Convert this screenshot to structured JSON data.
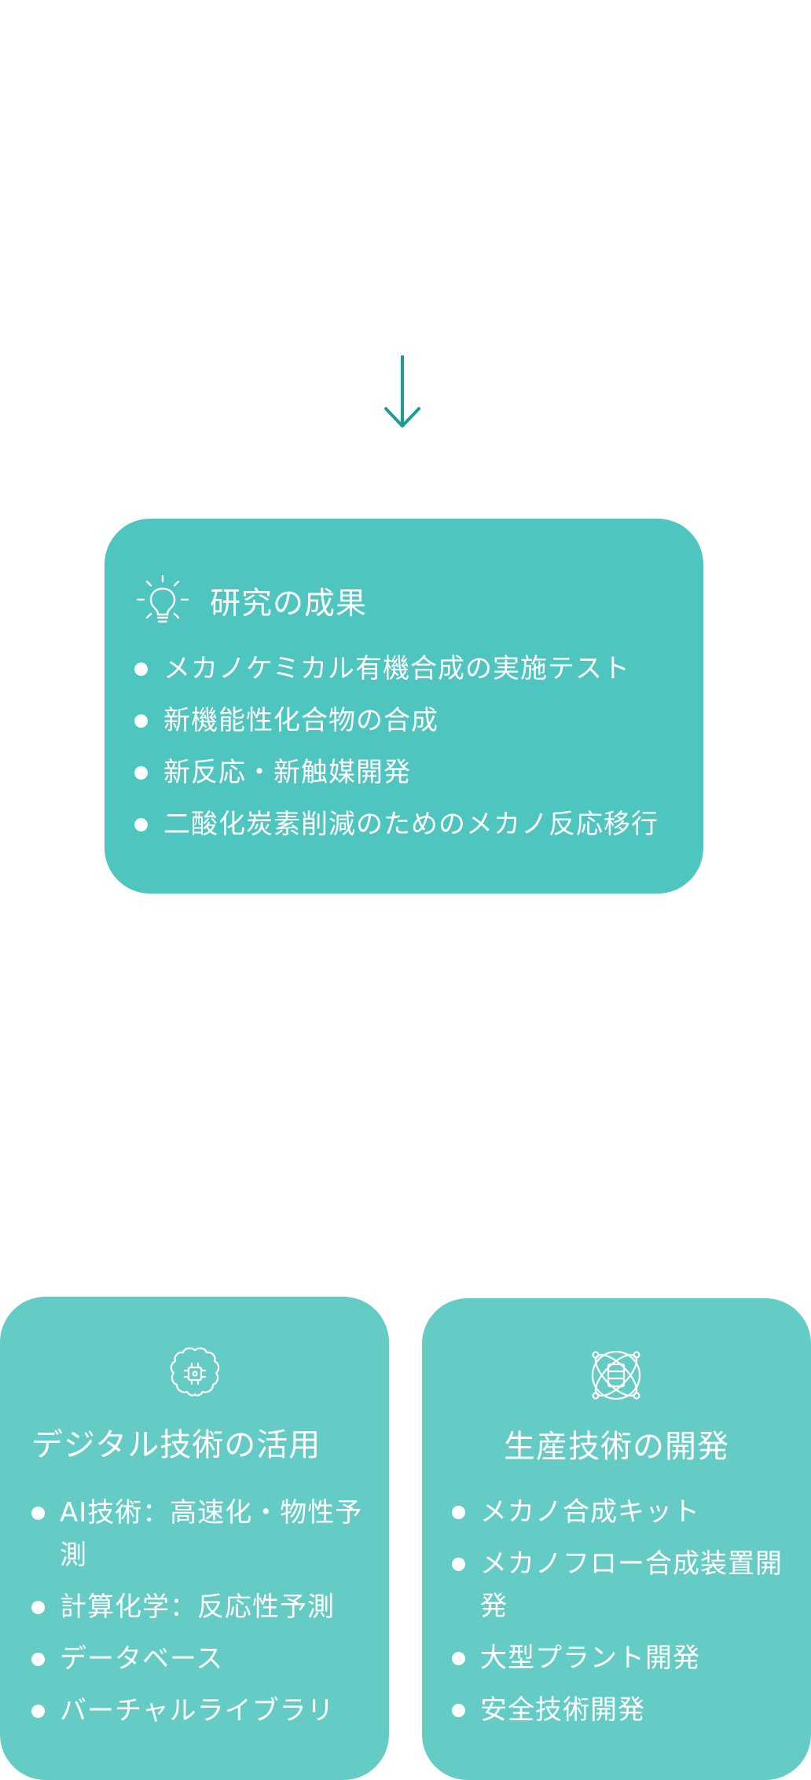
{
  "colors": {
    "accent": "#1a9d95",
    "card_primary": "#4fc5bf",
    "card_secondary": "#65ccc5"
  },
  "arrow": {
    "icon": "arrow-down-icon"
  },
  "results_card": {
    "icon": "lightbulb-icon",
    "title": "研究の成果",
    "items": [
      "メカノケミカル有機合成の実施テスト",
      "新機能性化合物の合成",
      "新反応・新触媒開発",
      "二酸化炭素削減のためのメカノ反応移行"
    ]
  },
  "digital_card": {
    "icon": "brain-chip-icon",
    "title": "デジタル技術の活用",
    "items": [
      "AI技術：高速化・物性予測",
      "計算化学：反応性予測",
      "データベース",
      "バーチャルライブラリ"
    ]
  },
  "production_card": {
    "icon": "orbit-server-icon",
    "title": "生産技術の開発",
    "items": [
      "メカノ合成キット",
      "メカノフロー合成装置開発",
      "大型プラント開発",
      "安全技術開発"
    ]
  }
}
